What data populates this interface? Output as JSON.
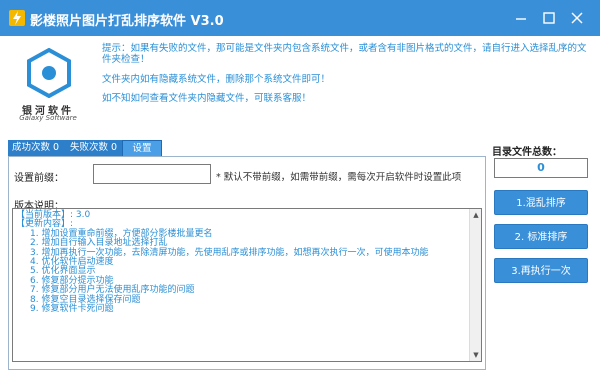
{
  "titlebar": {
    "title": "影楼照片图片打乱排序软件 V3.0",
    "icon": "app-bolt-icon",
    "buttons": [
      "minimize-icon",
      "maximize-icon",
      "close-icon"
    ]
  },
  "brand": {
    "name_cn": "银河软件",
    "name_en": "Galaxy Software"
  },
  "tips": {
    "line1": "提示：如果有失败的文件，那可能是文件夹内包含系统文件，或者含有非图片格式的文件，请自行进入选择乱序的文件夹检查！",
    "line2": "文件夹内如有隐藏系统文件，删除那个系统文件即可！",
    "line3": "如不知如何查看文件夹内隐藏文件，可联系客服！"
  },
  "tabs": {
    "success": "成功次数  0",
    "fail": "失败次数  0",
    "settings": "设置"
  },
  "settings": {
    "prefix_label": "设置前缀：",
    "prefix_value": "",
    "prefix_hint": "* 默认不带前缀，如需带前缀，需每次开启软件时设置此项",
    "notes_label": "版本说明：",
    "notes": [
      "【当前版本】: 3.0",
      "【更新内容】:",
      "1. 增加设置重命前缀，方便部分影楼批量更名",
      "2. 增加自行输入目录地址选择打乱",
      "3. 增加再执行一次功能，去除清屏功能，先使用乱序或排序功能，如想再次执行一次，可使用本功能",
      "4. 优化软件启动速度",
      "5. 优化界面显示",
      "6. 修复部分提示功能",
      "7. 修复部分用户无法使用乱序功能的问题",
      "8. 修复空目录选择保存问题",
      "9. 修复软件卡死问题"
    ]
  },
  "side": {
    "dir_total_label": "目录文件总数：",
    "dir_total_value": "0",
    "btn_shuffle": "1.混乱排序",
    "btn_sort": "2. 标准排序",
    "btn_rerun": "3.再执行一次"
  },
  "colors": {
    "titlebar": "#3a8fd9",
    "accent_text": "#2a8fd6",
    "button": "#3a8fd9"
  }
}
